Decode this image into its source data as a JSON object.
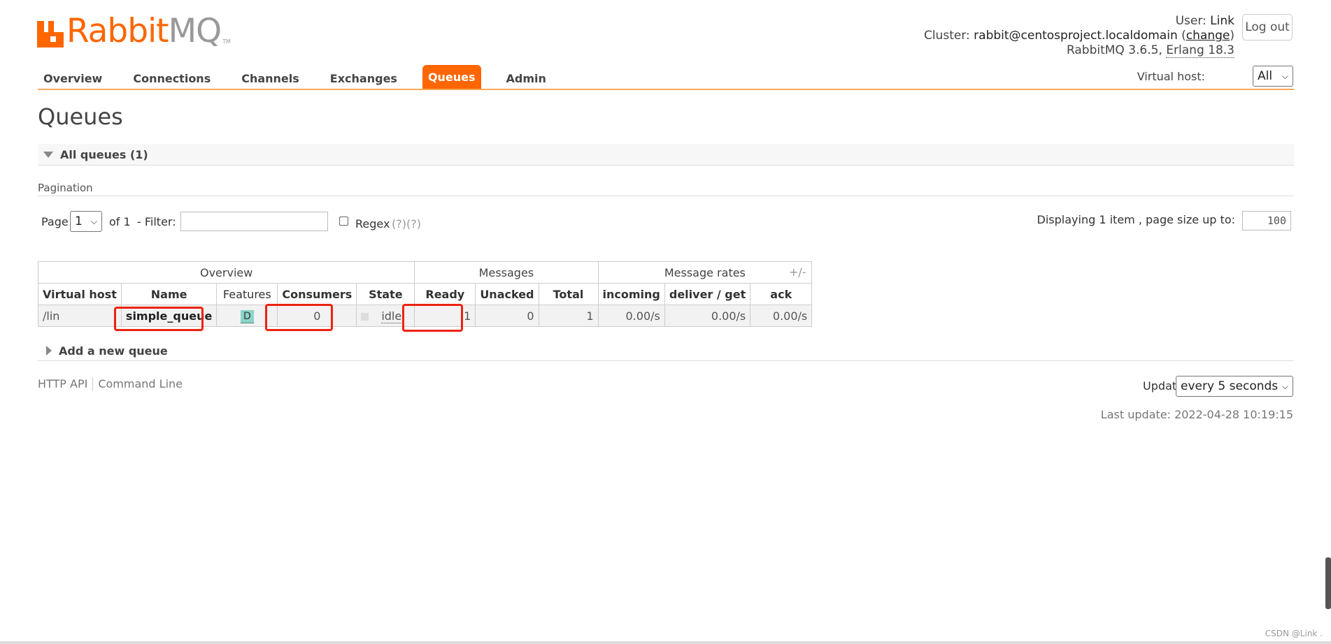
{
  "app": {
    "logo_main": "Rabbit",
    "logo_mq": "MQ",
    "logo_tm": "TM"
  },
  "header": {
    "user_label": "User:",
    "user_value": "Link",
    "cluster_label": "Cluster:",
    "cluster_value": "rabbit@centosproject.localdomain",
    "cluster_change": "change",
    "version_text": "RabbitMQ 3.6.5,",
    "erlang_text": "Erlang 18.3",
    "logout_label": "Log out"
  },
  "nav": {
    "tabs": [
      "Overview",
      "Connections",
      "Channels",
      "Exchanges",
      "Queues",
      "Admin"
    ],
    "active": "Queues",
    "vhost_label": "Virtual host:",
    "vhost_value": "All"
  },
  "page": {
    "title": "Queues",
    "section_all": "All queues (1)",
    "pagination_heading": "Pagination"
  },
  "pagination": {
    "page_label": "Page",
    "page_value": "1",
    "of_label": "of 1",
    "filter_label": "- Filter:",
    "filter_value": "",
    "regex_label": "Regex",
    "regex_help": "(?)(?)",
    "display_text": "Displaying 1 item , page size up to:",
    "page_size": "100"
  },
  "table": {
    "groups": [
      "Overview",
      "Messages",
      "Message rates"
    ],
    "plus_minus": "+/-",
    "columns": [
      "Virtual host",
      "Name",
      "Features",
      "Consumers",
      "State",
      "Ready",
      "Unacked",
      "Total",
      "incoming",
      "deliver / get",
      "ack"
    ],
    "rows": [
      {
        "vhost": "/lin",
        "name": "simple_queue",
        "feature": "D",
        "consumers": "0",
        "state": "idle",
        "ready": "1",
        "unacked": "0",
        "total": "1",
        "incoming": "0.00/s",
        "deliver_get": "0.00/s",
        "ack": "0.00/s"
      }
    ]
  },
  "add_queue": "Add a new queue",
  "footer": {
    "http_api": "HTTP API",
    "command_line": "Command Line",
    "update_label": "Update",
    "update_value": "every 5 seconds",
    "last_update": "Last update: 2022-04-28 10:19:15"
  },
  "watermark": "CSDN @Link .",
  "colors": {
    "accent": "#ff6600",
    "highlight": "#ee2211",
    "feature_badge": "#8ad4c8"
  }
}
